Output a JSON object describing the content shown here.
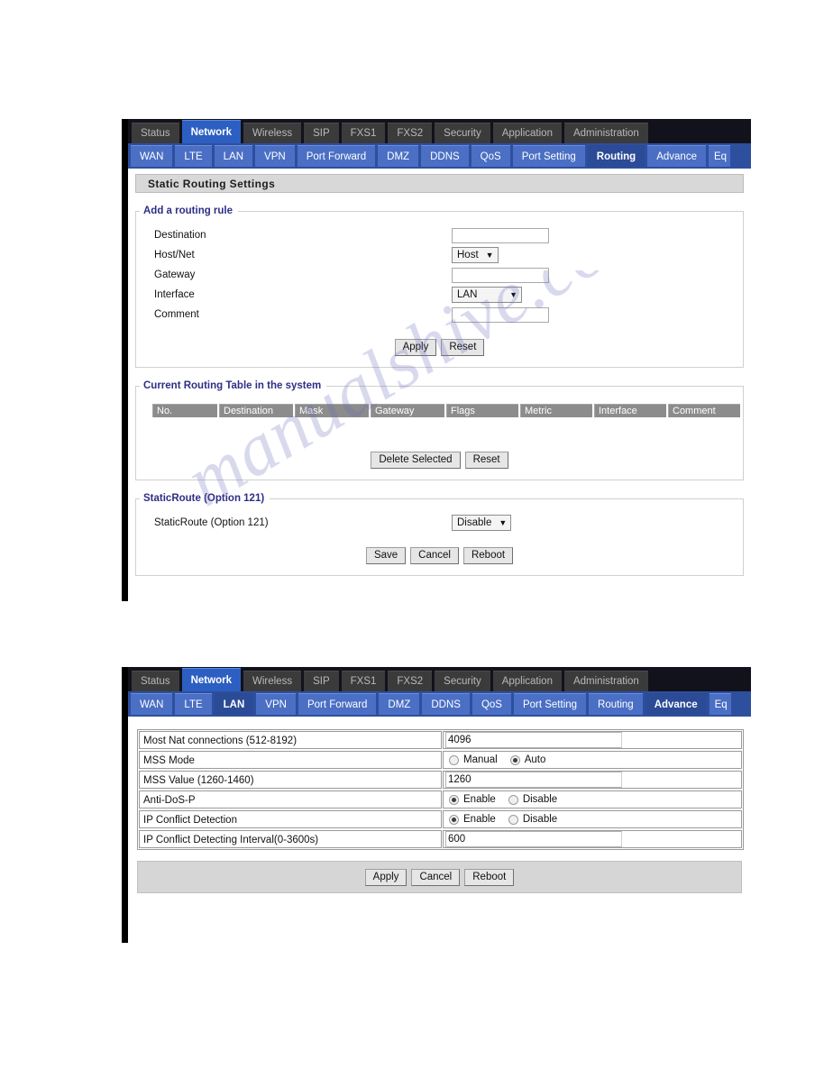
{
  "main_tabs": [
    {
      "label": "Status",
      "active": false
    },
    {
      "label": "Network",
      "active": true
    },
    {
      "label": "Wireless",
      "active": false
    },
    {
      "label": "SIP",
      "active": false
    },
    {
      "label": "FXS1",
      "active": false
    },
    {
      "label": "FXS2",
      "active": false
    },
    {
      "label": "Security",
      "active": false
    },
    {
      "label": "Application",
      "active": false
    },
    {
      "label": "Administration",
      "active": false
    }
  ],
  "sub_tabs_routing": [
    {
      "label": "WAN",
      "active": false
    },
    {
      "label": "LTE",
      "active": false
    },
    {
      "label": "LAN",
      "active": false
    },
    {
      "label": "VPN",
      "active": false
    },
    {
      "label": "Port Forward",
      "active": false
    },
    {
      "label": "DMZ",
      "active": false
    },
    {
      "label": "DDNS",
      "active": false
    },
    {
      "label": "QoS",
      "active": false
    },
    {
      "label": "Port Setting",
      "active": false
    },
    {
      "label": "Routing",
      "active": true
    },
    {
      "label": "Advance",
      "active": false
    },
    {
      "label": "Eq",
      "active": false
    }
  ],
  "sub_tabs_advance": [
    {
      "label": "WAN",
      "active": false
    },
    {
      "label": "LTE",
      "active": false
    },
    {
      "label": "LAN",
      "active": true
    },
    {
      "label": "VPN",
      "active": false
    },
    {
      "label": "Port Forward",
      "active": false
    },
    {
      "label": "DMZ",
      "active": false
    },
    {
      "label": "DDNS",
      "active": false
    },
    {
      "label": "QoS",
      "active": false
    },
    {
      "label": "Port Setting",
      "active": false
    },
    {
      "label": "Routing",
      "active": false
    },
    {
      "label": "Advance",
      "active": true
    },
    {
      "label": "Eq",
      "active": false
    }
  ],
  "routing_page": {
    "section_title": "Static Routing Settings",
    "add_rule": {
      "legend": "Add a routing rule",
      "fields": [
        {
          "label": "Destination",
          "type": "text",
          "value": ""
        },
        {
          "label": "Host/Net",
          "type": "select",
          "value": "Host"
        },
        {
          "label": "Gateway",
          "type": "text",
          "value": ""
        },
        {
          "label": "Interface",
          "type": "select",
          "value": "LAN"
        },
        {
          "label": "Comment",
          "type": "text",
          "value": ""
        }
      ],
      "apply_label": "Apply",
      "reset_label": "Reset"
    },
    "routing_table": {
      "legend": "Current Routing Table in the system",
      "columns": [
        "No.",
        "Destination",
        "Mask",
        "Gateway",
        "Flags",
        "Metric",
        "Interface",
        "Comment"
      ],
      "rows": [],
      "delete_label": "Delete Selected",
      "reset_label": "Reset"
    },
    "static_route": {
      "legend": "StaticRoute (Option 121)",
      "field_label": "StaticRoute (Option 121)",
      "field_value": "Disable",
      "save_label": "Save",
      "cancel_label": "Cancel",
      "reboot_label": "Reboot"
    }
  },
  "advance_page": {
    "rows": [
      {
        "label": "Most Nat connections (512-8192)",
        "type": "text",
        "value": "4096"
      },
      {
        "label": "MSS Mode",
        "type": "radio",
        "options": [
          "Manual",
          "Auto"
        ],
        "selected": "Auto"
      },
      {
        "label": "MSS Value (1260-1460)",
        "type": "text",
        "value": "1260"
      },
      {
        "label": "Anti-DoS-P",
        "type": "radio",
        "options": [
          "Enable",
          "Disable"
        ],
        "selected": "Enable"
      },
      {
        "label": "IP Conflict Detection",
        "type": "radio",
        "options": [
          "Enable",
          "Disable"
        ],
        "selected": "Enable"
      },
      {
        "label": "IP Conflict Detecting Interval(0-3600s)",
        "type": "text",
        "value": "600"
      }
    ],
    "apply_label": "Apply",
    "cancel_label": "Cancel",
    "reboot_label": "Reboot"
  },
  "watermark": {
    "text": "manualshive.com"
  },
  "colors": {
    "tab_active_blue": "#2c5fc1",
    "tab_sub_blue": "#4a6fc4",
    "tab_sub_active": "#2b4b96",
    "tab_main_gray": "#3b3b3b",
    "legend_text": "#2e2e86",
    "table_header_gray": "#8c8c8c"
  }
}
